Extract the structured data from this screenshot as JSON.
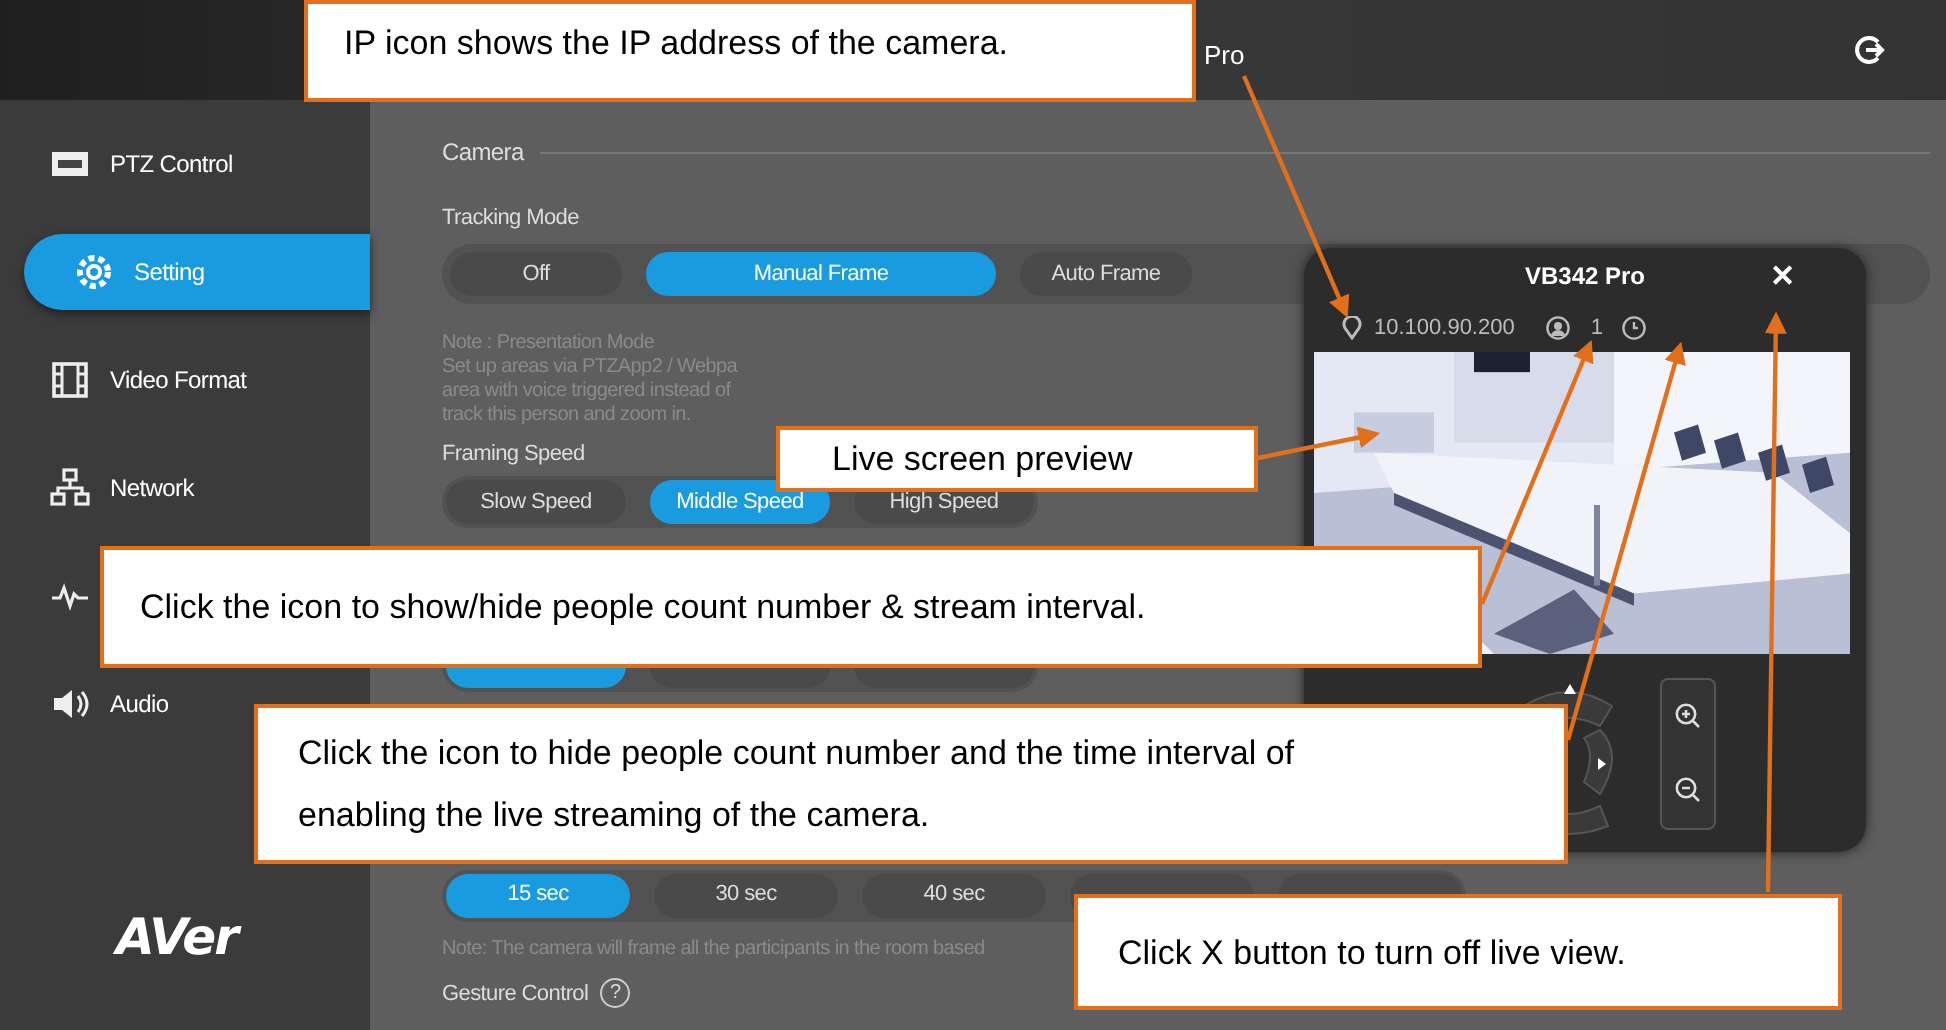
{
  "header": {
    "title": "Pro"
  },
  "sidebar": {
    "items": [
      {
        "kind": "ptz",
        "label": "PTZ Control",
        "selected": false
      },
      {
        "kind": "gear",
        "label": "Setting",
        "selected": true
      },
      {
        "kind": "film",
        "label": "Video Format",
        "selected": false
      },
      {
        "kind": "network",
        "label": "Network",
        "selected": false
      },
      {
        "kind": "wave",
        "selected": false
      },
      {
        "kind": "audio",
        "label": "Audio",
        "selected": false
      }
    ],
    "logo": "AVer"
  },
  "main": {
    "section": "Camera",
    "tracking": {
      "label": "Tracking Mode",
      "options": [
        {
          "label": "Off",
          "selected": false
        },
        {
          "label": "Manual Frame",
          "selected": true
        },
        {
          "label": "Auto Frame",
          "selected": false
        }
      ]
    },
    "note": [
      "Note : Presentation Mode",
      "Set up areas via PTZApp2 / Webpa",
      "area with voice triggered instead of",
      "track this person and zoom in."
    ],
    "framing": {
      "label": "Framing Speed",
      "options": [
        {
          "label": "Slow Speed",
          "selected": false
        },
        {
          "label": "Middle Speed",
          "selected": true
        },
        {
          "label": "High Speed",
          "selected": false
        }
      ]
    },
    "hidden_row": [
      {
        "selected": true
      },
      {
        "selected": false
      },
      {
        "selected": false
      }
    ],
    "interval": {
      "options": [
        {
          "label": "15 sec",
          "selected": true
        },
        {
          "label": "30 sec",
          "selected": false
        },
        {
          "label": "40 sec",
          "selected": false
        },
        {
          "selected": false
        },
        {
          "selected": false
        }
      ]
    },
    "note2": "Note: The camera will frame all the participants in the room based",
    "gesture": {
      "label": "Gesture Control",
      "help": "?"
    }
  },
  "live_view": {
    "title": "VB342 Pro",
    "close": "✕",
    "ip": "10.100.90.200",
    "people": "1"
  },
  "callouts": [
    {
      "kind": "ip",
      "text": "IP icon shows the IP address of the camera."
    },
    {
      "kind": "preview",
      "text": "Live screen preview"
    },
    {
      "kind": "toggle",
      "text": "Click the icon to show/hide people count number & stream interval."
    },
    {
      "kind": "hide",
      "text": "Click the icon to hide people count number and the time interval of enabling the live streaming of the camera."
    },
    {
      "kind": "close",
      "text": "Click X button to turn off live view."
    }
  ]
}
